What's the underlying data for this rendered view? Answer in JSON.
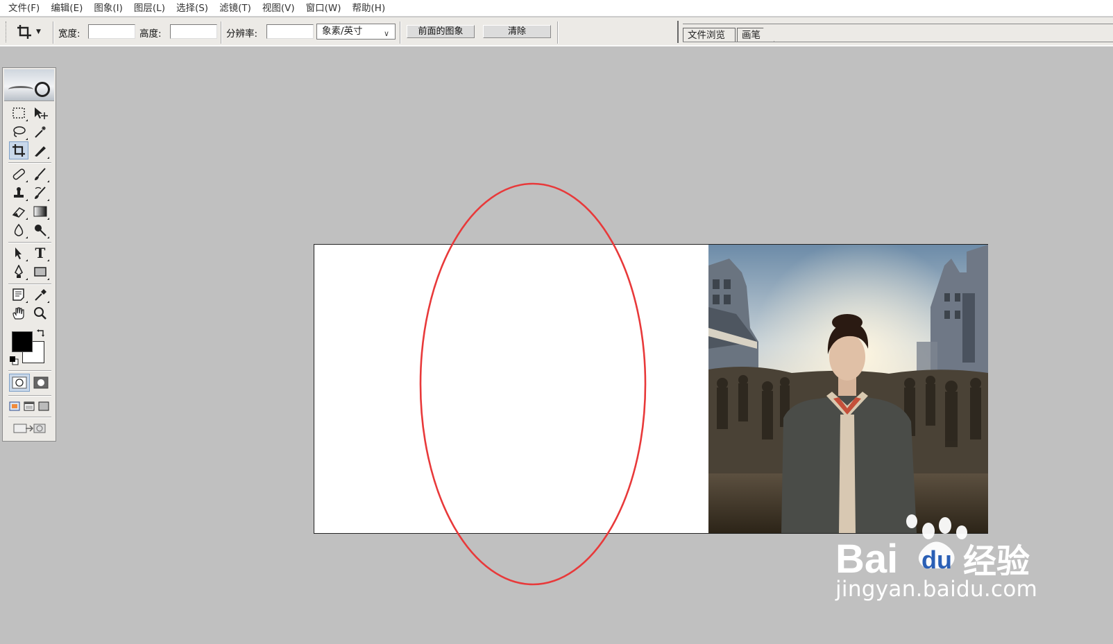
{
  "menubar": {
    "items": [
      "文件(F)",
      "编辑(E)",
      "图象(I)",
      "图层(L)",
      "选择(S)",
      "滤镜(T)",
      "视图(V)",
      "窗口(W)",
      "帮助(H)"
    ]
  },
  "options": {
    "width_label": "宽度:",
    "width_value": "",
    "height_label": "高度:",
    "height_value": "",
    "resolution_label": "分辨率:",
    "resolution_value": "",
    "unit_select": "象素/英寸",
    "front_image_button": "前面的图象",
    "clear_button": "清除"
  },
  "palette_well": {
    "tabs": [
      "文件浏览",
      "画笔"
    ]
  },
  "toolbox": {
    "tools": [
      "rectangular-marquee",
      "move",
      "lasso",
      "magic-wand",
      "crop",
      "slice",
      "healing-brush",
      "brush",
      "clone-stamp",
      "history-brush",
      "eraser",
      "gradient",
      "blur",
      "dodge",
      "path-selection",
      "type",
      "pen",
      "rectangle-shape",
      "notes",
      "eyedropper",
      "hand",
      "zoom"
    ],
    "active_tool": "crop",
    "foreground_color": "#000000",
    "background_color": "#ffffff"
  },
  "document": {
    "photo_description_icon": "photo-thumbnail"
  },
  "annotation": {
    "color": "#e8393a"
  },
  "watermark": {
    "brand": "Bai",
    "brand_tail": "du",
    "suffix": "经验",
    "url": "jingyan.baidu.com"
  }
}
